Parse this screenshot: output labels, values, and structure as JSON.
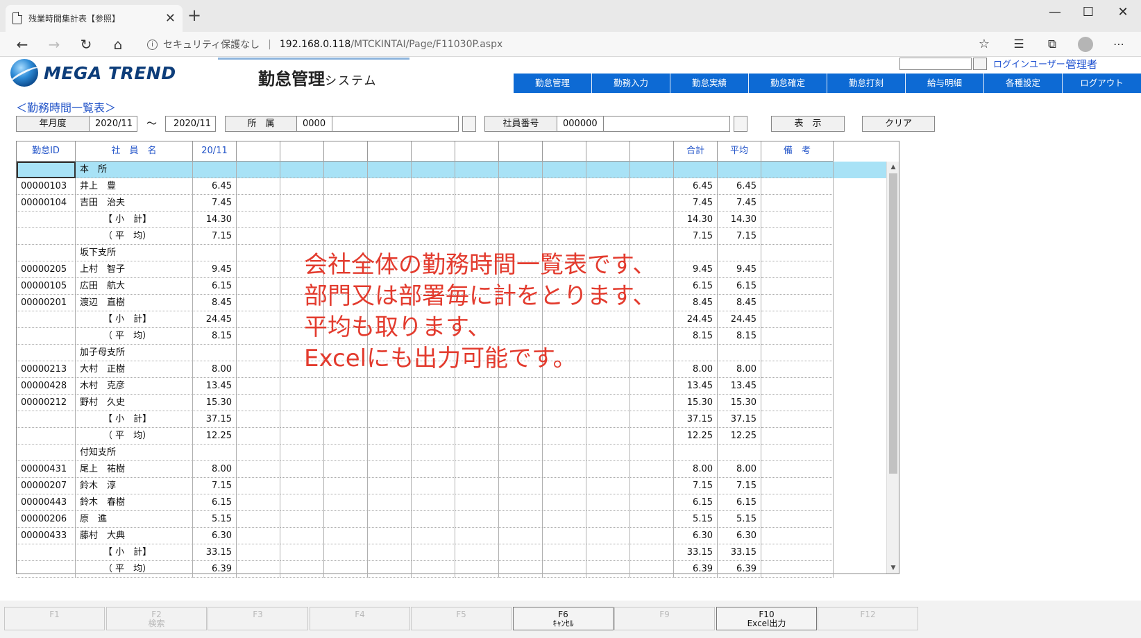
{
  "browser": {
    "tab_title": "残業時間集計表【参照】",
    "url_warning": "セキュリティ保護なし",
    "url_separator": "|",
    "url_host": "192.168.0.118",
    "url_path": "/MTCKINTAI/Page/F11030P.aspx"
  },
  "header": {
    "logo_text": "MEGA TREND",
    "system_title": "勤怠管理",
    "system_subtitle": "システム",
    "login_label": "ログインユーザー:",
    "login_user": "管理者",
    "menu": [
      "勤怠管理",
      "勤務入力",
      "勤怠実績",
      "勤怠確定",
      "勤怠打刻",
      "給与明細",
      "各種設定",
      "ログアウト"
    ]
  },
  "page": {
    "section_title": "＜勤務時間一覧表＞",
    "filters": {
      "period_label": "年月度",
      "period_from": "2020/11",
      "tilde": "～",
      "period_to": "2020/11",
      "dept_label": "所　属",
      "dept_code": "0000",
      "dept_name": "",
      "emp_label": "社員番号",
      "emp_code": "000000",
      "emp_name": "",
      "show_button": "表　示",
      "clear_button": "クリア"
    }
  },
  "grid": {
    "columns": [
      "勤怠ID",
      "社　員　名",
      "20/11",
      "",
      "",
      "",
      "",
      "",
      "",
      "",
      "",
      "",
      "",
      "合計",
      "平均",
      "備　考"
    ],
    "rows": [
      {
        "type": "group",
        "id": "",
        "name": "本　所",
        "d1": "",
        "total": "",
        "avg": ""
      },
      {
        "type": "emp",
        "id": "00000103",
        "name": "井上　豊",
        "d1": "6.45",
        "total": "6.45",
        "avg": "6.45"
      },
      {
        "type": "emp",
        "id": "00000104",
        "name": "吉田　治夫",
        "d1": "7.45",
        "total": "7.45",
        "avg": "7.45"
      },
      {
        "type": "sub",
        "id": "",
        "name": "【 小　計】",
        "d1": "14.30",
        "total": "14.30",
        "avg": "14.30"
      },
      {
        "type": "sub",
        "id": "",
        "name": "（ 平　均）",
        "d1": "7.15",
        "total": "7.15",
        "avg": "7.15"
      },
      {
        "type": "dept",
        "id": "",
        "name": "坂下支所",
        "d1": "",
        "total": "",
        "avg": ""
      },
      {
        "type": "emp",
        "id": "00000205",
        "name": "上村　智子",
        "d1": "9.45",
        "total": "9.45",
        "avg": "9.45"
      },
      {
        "type": "emp",
        "id": "00000105",
        "name": "広田　航大",
        "d1": "6.15",
        "total": "6.15",
        "avg": "6.15"
      },
      {
        "type": "emp",
        "id": "00000201",
        "name": "渡辺　直樹",
        "d1": "8.45",
        "total": "8.45",
        "avg": "8.45"
      },
      {
        "type": "sub",
        "id": "",
        "name": "【 小　計】",
        "d1": "24.45",
        "total": "24.45",
        "avg": "24.45"
      },
      {
        "type": "sub",
        "id": "",
        "name": "（ 平　均）",
        "d1": "8.15",
        "total": "8.15",
        "avg": "8.15"
      },
      {
        "type": "dept",
        "id": "",
        "name": "加子母支所",
        "d1": "",
        "total": "",
        "avg": ""
      },
      {
        "type": "emp",
        "id": "00000213",
        "name": "大村　正樹",
        "d1": "8.00",
        "total": "8.00",
        "avg": "8.00"
      },
      {
        "type": "emp",
        "id": "00000428",
        "name": "木村　克彦",
        "d1": "13.45",
        "total": "13.45",
        "avg": "13.45"
      },
      {
        "type": "emp",
        "id": "00000212",
        "name": "野村　久史",
        "d1": "15.30",
        "total": "15.30",
        "avg": "15.30"
      },
      {
        "type": "sub",
        "id": "",
        "name": "【 小　計】",
        "d1": "37.15",
        "total": "37.15",
        "avg": "37.15"
      },
      {
        "type": "sub",
        "id": "",
        "name": "（ 平　均）",
        "d1": "12.25",
        "total": "12.25",
        "avg": "12.25"
      },
      {
        "type": "dept",
        "id": "",
        "name": "付知支所",
        "d1": "",
        "total": "",
        "avg": ""
      },
      {
        "type": "emp",
        "id": "00000431",
        "name": "尾上　祐樹",
        "d1": "8.00",
        "total": "8.00",
        "avg": "8.00"
      },
      {
        "type": "emp",
        "id": "00000207",
        "name": "鈴木　淳",
        "d1": "7.15",
        "total": "7.15",
        "avg": "7.15"
      },
      {
        "type": "emp",
        "id": "00000443",
        "name": "鈴木　春樹",
        "d1": "6.15",
        "total": "6.15",
        "avg": "6.15"
      },
      {
        "type": "emp",
        "id": "00000206",
        "name": "原　進",
        "d1": "5.15",
        "total": "5.15",
        "avg": "5.15"
      },
      {
        "type": "emp",
        "id": "00000433",
        "name": "藤村　大典",
        "d1": "6.30",
        "total": "6.30",
        "avg": "6.30"
      },
      {
        "type": "sub",
        "id": "",
        "name": "【 小　計】",
        "d1": "33.15",
        "total": "33.15",
        "avg": "33.15"
      },
      {
        "type": "sub",
        "id": "",
        "name": "（ 平　均）",
        "d1": "6.39",
        "total": "6.39",
        "avg": "6.39"
      }
    ]
  },
  "annotation": [
    "会社全体の勤務時間一覧表です、",
    "部門又は部署毎に計をとります、",
    "平均も取ります、",
    "Excelにも出力可能です。"
  ],
  "fkeys": [
    {
      "key": "F1",
      "label": "",
      "active": false
    },
    {
      "key": "F2",
      "label": "検索",
      "active": false
    },
    {
      "key": "F3",
      "label": "",
      "active": false
    },
    {
      "key": "F4",
      "label": "",
      "active": false
    },
    {
      "key": "F5",
      "label": "",
      "active": false
    },
    {
      "key": "F6",
      "label": "ｷｬﾝｾﾙ",
      "active": true
    },
    {
      "key": "F9",
      "label": "",
      "active": false
    },
    {
      "key": "F10",
      "label": "Excel出力",
      "active": true
    },
    {
      "key": "F12",
      "label": "",
      "active": false
    }
  ],
  "colors": {
    "accent": "#0d6ad4",
    "group_row": "#a8e2f6",
    "annotation": "#e33b2e",
    "link": "#2153c8"
  }
}
